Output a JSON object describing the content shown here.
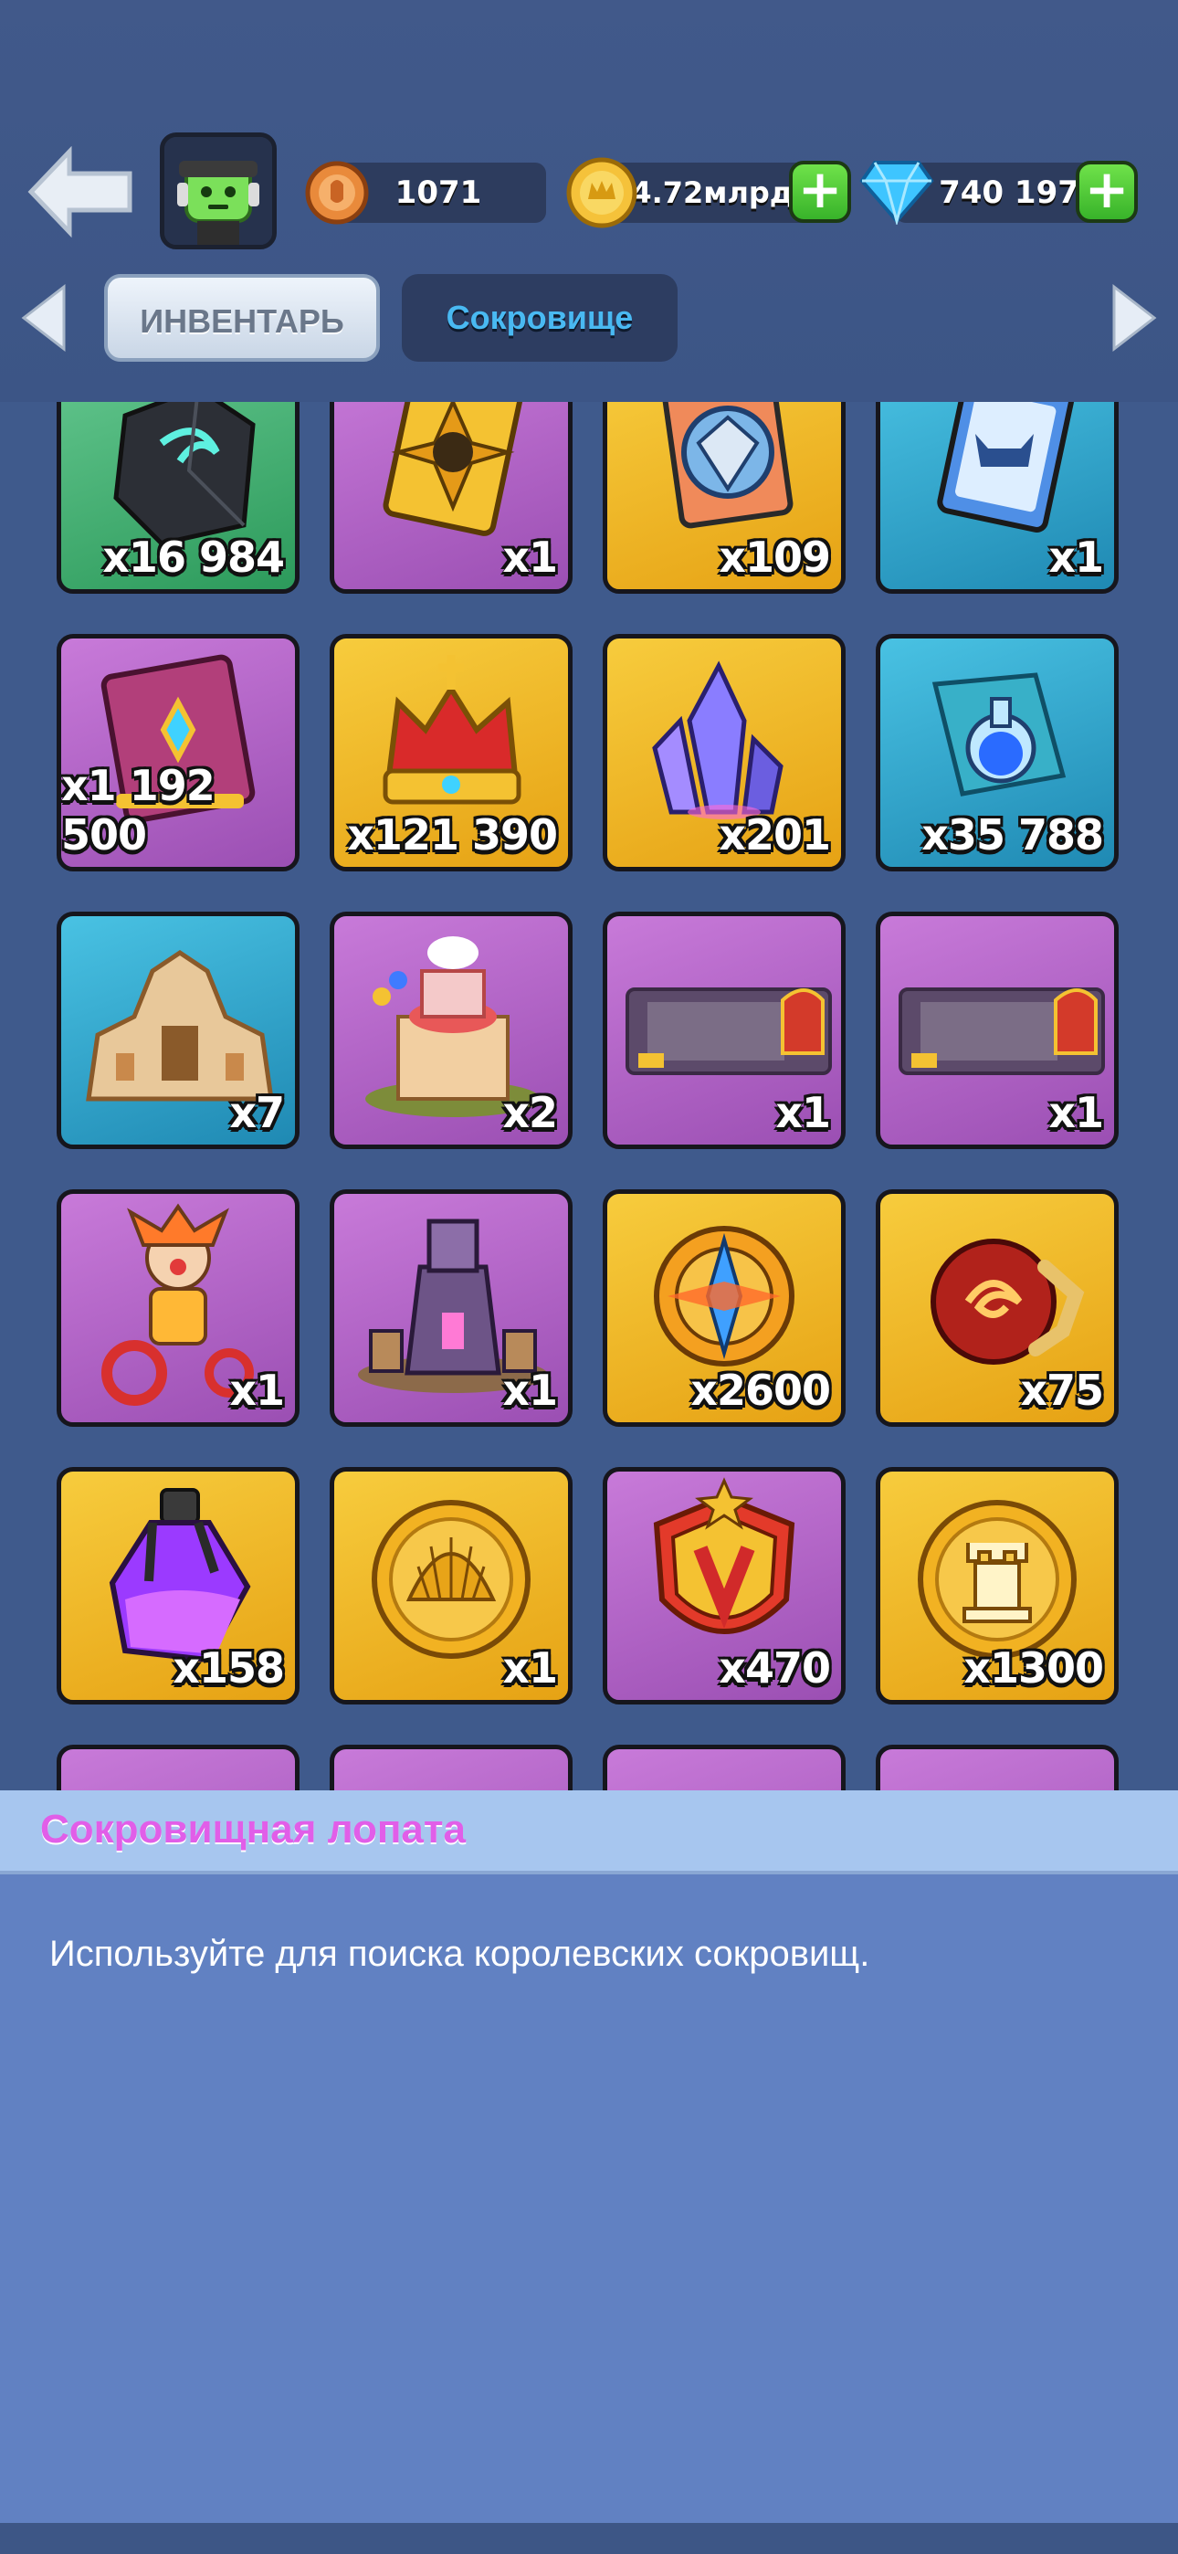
{
  "header": {
    "trophies": "1071",
    "gold": "4.72млрд",
    "gems": "740 197"
  },
  "tabs": [
    {
      "label": "ИНВЕНТАРЬ",
      "active": false
    },
    {
      "label": "Сокровище",
      "active": true
    }
  ],
  "items": [
    {
      "icon": "dark-stone-icon",
      "qty": "x16 984",
      "color": "green"
    },
    {
      "icon": "golden-banner-card-icon",
      "qty": "x1",
      "color": "purple"
    },
    {
      "icon": "silver-crest-card-icon",
      "qty": "x109",
      "color": "gold"
    },
    {
      "icon": "blue-horned-card-icon",
      "qty": "x1",
      "color": "blue"
    },
    {
      "icon": "magic-book-icon",
      "qty": "x1 192 500",
      "color": "purple"
    },
    {
      "icon": "royal-crown-icon",
      "qty": "x121 390",
      "color": "gold"
    },
    {
      "icon": "crystal-cluster-icon",
      "qty": "x201",
      "color": "gold"
    },
    {
      "icon": "potion-puzzle-icon",
      "qty": "x35 788",
      "color": "blue"
    },
    {
      "icon": "sandstone-palace-icon",
      "qty": "x7",
      "color": "blue"
    },
    {
      "icon": "birthday-castle-icon",
      "qty": "x2",
      "color": "purple"
    },
    {
      "icon": "party-banner-icon",
      "qty": "x1",
      "color": "purple"
    },
    {
      "icon": "party-banner-icon",
      "qty": "x1",
      "color": "purple"
    },
    {
      "icon": "jester-tricycle-icon",
      "qty": "x1",
      "color": "purple"
    },
    {
      "icon": "dark-tower-icon",
      "qty": "x1",
      "color": "purple"
    },
    {
      "icon": "compass-medallion-icon",
      "qty": "x2600",
      "color": "gold"
    },
    {
      "icon": "dragon-orb-icon",
      "qty": "x75",
      "color": "gold"
    },
    {
      "icon": "purple-elixir-icon",
      "qty": "x158",
      "color": "gold"
    },
    {
      "icon": "shell-coin-icon",
      "qty": "x1",
      "color": "gold"
    },
    {
      "icon": "victory-shield-icon",
      "qty": "x470",
      "color": "purple"
    },
    {
      "icon": "rook-coin-icon",
      "qty": "x1300",
      "color": "gold"
    }
  ],
  "info": {
    "title": "Сокровищная лопата",
    "description": "Используйте для поиска королевских сокровищ."
  },
  "colors": {
    "background": "#3f5a8c",
    "card_purple": "#b466c9",
    "card_gold": "#f0b82a",
    "card_blue": "#33a8d1",
    "card_green": "#4bb577",
    "info_title": "#e15ee8",
    "info_panel": "#6181c2"
  }
}
